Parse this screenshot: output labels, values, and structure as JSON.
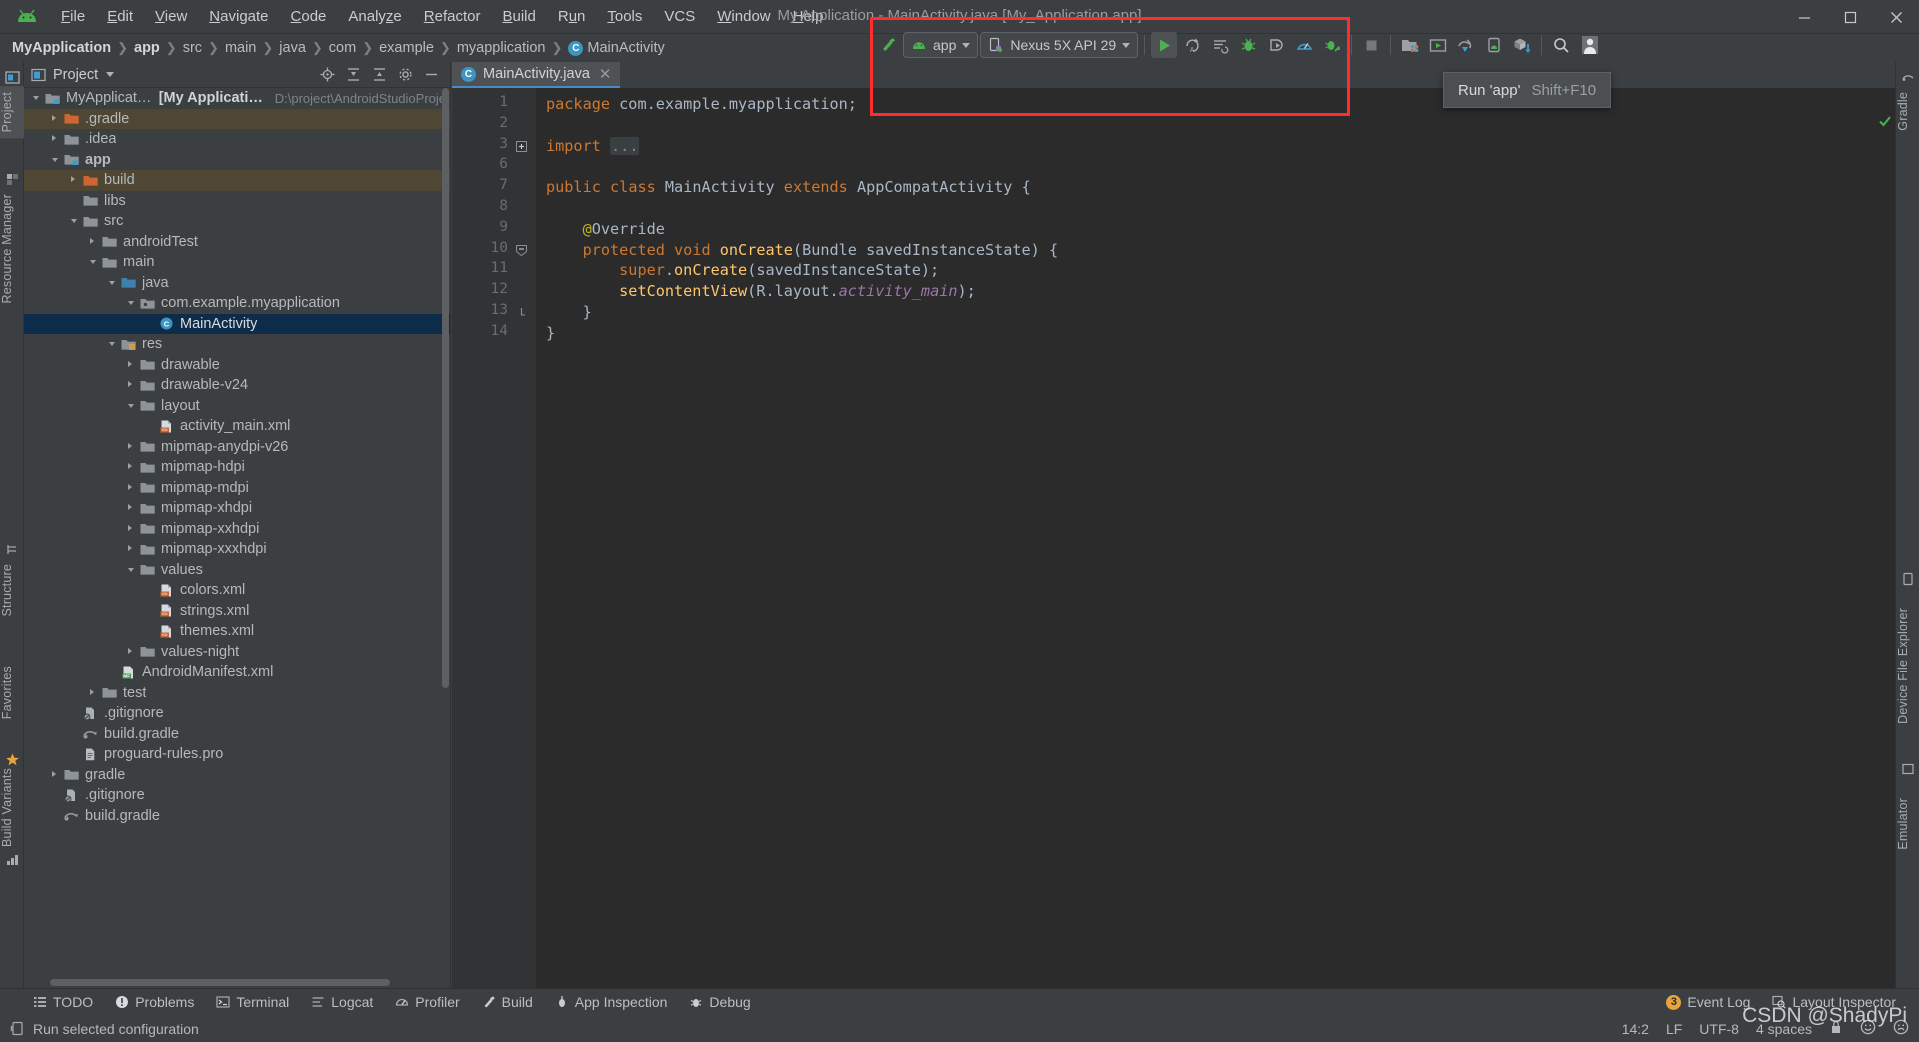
{
  "window": {
    "title": "My Application - MainActivity.java [My_Application.app]",
    "app_logo": "android-logo-icon",
    "minimize": "minimize-icon",
    "maximize": "maximize-icon",
    "close": "close-icon"
  },
  "menu": [
    {
      "label": "File",
      "mnemonic": "F"
    },
    {
      "label": "Edit",
      "mnemonic": "E"
    },
    {
      "label": "View",
      "mnemonic": "V"
    },
    {
      "label": "Navigate",
      "mnemonic": "N"
    },
    {
      "label": "Code",
      "mnemonic": "C"
    },
    {
      "label": "Analyze",
      "mnemonic": "z"
    },
    {
      "label": "Refactor",
      "mnemonic": "R"
    },
    {
      "label": "Build",
      "mnemonic": "B"
    },
    {
      "label": "Run",
      "mnemonic": "u"
    },
    {
      "label": "Tools",
      "mnemonic": "T"
    },
    {
      "label": "VCS",
      "mnemonic": ""
    },
    {
      "label": "Window",
      "mnemonic": "W"
    },
    {
      "label": "Help",
      "mnemonic": "H"
    }
  ],
  "breadcrumbs": [
    {
      "label": "MyApplication",
      "bold": true,
      "icon": ""
    },
    {
      "label": "app",
      "bold": true,
      "icon": ""
    },
    {
      "label": "src",
      "bold": false,
      "icon": ""
    },
    {
      "label": "main",
      "bold": false,
      "icon": ""
    },
    {
      "label": "java",
      "bold": false,
      "icon": ""
    },
    {
      "label": "com",
      "bold": false,
      "icon": ""
    },
    {
      "label": "example",
      "bold": false,
      "icon": ""
    },
    {
      "label": "myapplication",
      "bold": false,
      "icon": ""
    },
    {
      "label": "MainActivity",
      "bold": false,
      "icon": "class-icon"
    }
  ],
  "toolbar": {
    "build_icon": "hammer-icon",
    "module_selector": "app",
    "module_icon": "android-head-icon",
    "device_selector": "Nexus 5X API 29",
    "device_icon": "phone-icon",
    "run_button": "run-icon",
    "apply_changes_icon": "apply-changes-icon",
    "apply_code_changes_icon": "apply-code-changes-icon",
    "debug_icon": "debug-icon",
    "attach_debugger_icon": "attach-debugger-icon",
    "profiler_icon": "profiler-icon",
    "run_with_coverage_icon": "debug-attach-icon",
    "stop_icon": "stop-icon",
    "sdk_manager_icon": "sdk-manager-icon",
    "avd_manager_icon": "avd-manager-icon",
    "sync_gradle_icon": "sync-gradle-icon",
    "device_manager_icon": "device-manager-icon",
    "sdk_download_icon": "sdk-download-icon",
    "search_icon": "search-icon",
    "account_icon": "account-icon"
  },
  "tooltip": {
    "label": "Run 'app'",
    "shortcut": "Shift+F10"
  },
  "left_tool_tabs": [
    {
      "label": "Project",
      "icon": "project-icon",
      "active": true
    },
    {
      "label": "Resource Manager",
      "icon": "resource-icon",
      "active": false
    },
    {
      "label": "Structure",
      "icon": "structure-icon",
      "active": false
    },
    {
      "label": "Favorites",
      "icon": "star-icon",
      "active": false
    },
    {
      "label": "Build Variants",
      "icon": "build-variants-icon",
      "active": false
    }
  ],
  "right_tool_tabs": [
    {
      "label": "Gradle",
      "icon": "gradle-icon"
    },
    {
      "label": "Device File Explorer",
      "icon": "device-file-icon"
    },
    {
      "label": "Emulator",
      "icon": "emulator-icon"
    }
  ],
  "project_panel": {
    "title": "Project",
    "view_icon": "project-view-icon",
    "dropdown_icon": "chevron-down-icon",
    "icons": [
      "locate-icon",
      "expand-all-icon",
      "collapse-all-icon",
      "settings-icon",
      "hide-icon"
    ],
    "tree": [
      {
        "indent": 0,
        "arrow": "open",
        "icon": "module-folder",
        "label": "MyApplication",
        "bold_part": "[My Application]",
        "path": "D:\\project\\AndroidStudioProje",
        "state": "normal"
      },
      {
        "indent": 1,
        "arrow": "closed",
        "icon": "folder-orange",
        "label": ".gradle",
        "state": "excluded"
      },
      {
        "indent": 1,
        "arrow": "closed",
        "icon": "folder-gray",
        "label": ".idea",
        "state": "normal"
      },
      {
        "indent": 1,
        "arrow": "open",
        "icon": "module-folder",
        "label": "app",
        "bold": true,
        "state": "normal"
      },
      {
        "indent": 2,
        "arrow": "closed",
        "icon": "folder-orange",
        "label": "build",
        "state": "excluded"
      },
      {
        "indent": 2,
        "arrow": "none",
        "icon": "folder-gray",
        "label": "libs",
        "state": "normal"
      },
      {
        "indent": 2,
        "arrow": "open",
        "icon": "folder-gray",
        "label": "src",
        "state": "normal"
      },
      {
        "indent": 3,
        "arrow": "closed",
        "icon": "folder-gray",
        "label": "androidTest",
        "state": "normal"
      },
      {
        "indent": 3,
        "arrow": "open",
        "icon": "folder-gray",
        "label": "main",
        "state": "normal"
      },
      {
        "indent": 4,
        "arrow": "open",
        "icon": "folder-blue",
        "label": "java",
        "state": "normal"
      },
      {
        "indent": 5,
        "arrow": "open",
        "icon": "package-icon",
        "label": "com.example.myapplication",
        "state": "normal"
      },
      {
        "indent": 6,
        "arrow": "none",
        "icon": "class-icon",
        "label": "MainActivity",
        "state": "selected"
      },
      {
        "indent": 4,
        "arrow": "open",
        "icon": "res-folder",
        "label": "res",
        "state": "normal"
      },
      {
        "indent": 5,
        "arrow": "closed",
        "icon": "folder-gray",
        "label": "drawable",
        "state": "normal"
      },
      {
        "indent": 5,
        "arrow": "closed",
        "icon": "folder-gray",
        "label": "drawable-v24",
        "state": "normal"
      },
      {
        "indent": 5,
        "arrow": "open",
        "icon": "folder-gray",
        "label": "layout",
        "state": "normal"
      },
      {
        "indent": 6,
        "arrow": "none",
        "icon": "xml-icon",
        "label": "activity_main.xml",
        "state": "normal"
      },
      {
        "indent": 5,
        "arrow": "closed",
        "icon": "folder-gray",
        "label": "mipmap-anydpi-v26",
        "state": "normal"
      },
      {
        "indent": 5,
        "arrow": "closed",
        "icon": "folder-gray",
        "label": "mipmap-hdpi",
        "state": "normal"
      },
      {
        "indent": 5,
        "arrow": "closed",
        "icon": "folder-gray",
        "label": "mipmap-mdpi",
        "state": "normal"
      },
      {
        "indent": 5,
        "arrow": "closed",
        "icon": "folder-gray",
        "label": "mipmap-xhdpi",
        "state": "normal"
      },
      {
        "indent": 5,
        "arrow": "closed",
        "icon": "folder-gray",
        "label": "mipmap-xxhdpi",
        "state": "normal"
      },
      {
        "indent": 5,
        "arrow": "closed",
        "icon": "folder-gray",
        "label": "mipmap-xxxhdpi",
        "state": "normal"
      },
      {
        "indent": 5,
        "arrow": "open",
        "icon": "folder-gray",
        "label": "values",
        "state": "normal"
      },
      {
        "indent": 6,
        "arrow": "none",
        "icon": "xml-icon",
        "label": "colors.xml",
        "state": "normal"
      },
      {
        "indent": 6,
        "arrow": "none",
        "icon": "xml-icon",
        "label": "strings.xml",
        "state": "normal"
      },
      {
        "indent": 6,
        "arrow": "none",
        "icon": "xml-icon",
        "label": "themes.xml",
        "state": "normal"
      },
      {
        "indent": 5,
        "arrow": "closed",
        "icon": "folder-gray",
        "label": "values-night",
        "state": "normal"
      },
      {
        "indent": 4,
        "arrow": "none",
        "icon": "manifest-icon",
        "label": "AndroidManifest.xml",
        "state": "normal"
      },
      {
        "indent": 3,
        "arrow": "closed",
        "icon": "folder-gray",
        "label": "test",
        "state": "normal"
      },
      {
        "indent": 2,
        "arrow": "none",
        "icon": "gitignore-icon",
        "label": ".gitignore",
        "state": "normal"
      },
      {
        "indent": 2,
        "arrow": "none",
        "icon": "gradle-file-icon",
        "label": "build.gradle",
        "state": "normal"
      },
      {
        "indent": 2,
        "arrow": "none",
        "icon": "text-file-icon",
        "label": "proguard-rules.pro",
        "state": "normal"
      },
      {
        "indent": 1,
        "arrow": "closed",
        "icon": "folder-gray",
        "label": "gradle",
        "state": "normal"
      },
      {
        "indent": 1,
        "arrow": "none",
        "icon": "gitignore-icon",
        "label": ".gitignore",
        "state": "normal"
      },
      {
        "indent": 1,
        "arrow": "none",
        "icon": "gradle-file-icon",
        "label": "build.gradle",
        "state": "normal"
      }
    ]
  },
  "editor": {
    "tab": {
      "label": "MainActivity.java",
      "icon": "class-icon",
      "close": "close-icon"
    },
    "lines": [
      {
        "num": "1",
        "mark": "",
        "fold": ""
      },
      {
        "num": "2",
        "mark": "",
        "fold": ""
      },
      {
        "num": "3",
        "mark": "",
        "fold": "plus"
      },
      {
        "num": "6",
        "mark": "",
        "fold": ""
      },
      {
        "num": "7",
        "mark": "xml-icon",
        "fold": ""
      },
      {
        "num": "8",
        "mark": "",
        "fold": ""
      },
      {
        "num": "9",
        "mark": "",
        "fold": ""
      },
      {
        "num": "10",
        "mark": "override-icon",
        "fold": "minus"
      },
      {
        "num": "11",
        "mark": "",
        "fold": ""
      },
      {
        "num": "12",
        "mark": "",
        "fold": ""
      },
      {
        "num": "13",
        "mark": "",
        "fold": "end"
      },
      {
        "num": "14",
        "mark": "",
        "fold": ""
      }
    ],
    "code_text": [
      "package com.example.myapplication;",
      "",
      "import ...",
      "",
      "public class MainActivity extends AppCompatActivity {",
      "",
      "    @Override",
      "    protected void onCreate(Bundle savedInstanceState) {",
      "        super.onCreate(savedInstanceState);",
      "        setContentView(R.layout.activity_main);",
      "    }",
      "}"
    ],
    "inspection_status": "check-icon"
  },
  "bottom_tabs": [
    {
      "label": "TODO",
      "icon": "todo-icon"
    },
    {
      "label": "Problems",
      "icon": "problems-icon"
    },
    {
      "label": "Terminal",
      "icon": "terminal-icon"
    },
    {
      "label": "Logcat",
      "icon": "logcat-icon"
    },
    {
      "label": "Profiler",
      "icon": "profiler-icon"
    },
    {
      "label": "Build",
      "icon": "build-icon"
    },
    {
      "label": "App Inspection",
      "icon": "app-inspection-icon"
    },
    {
      "label": "Debug",
      "icon": "debug-icon"
    }
  ],
  "bottom_right": [
    {
      "label": "Event Log",
      "icon": "event-log-icon",
      "badge": "3"
    },
    {
      "label": "Layout Inspector",
      "icon": "layout-inspector-icon",
      "badge": ""
    }
  ],
  "statusbar": {
    "message": "Run selected configuration",
    "message_icon": "run-config-icon",
    "caret_position": "14:2",
    "line_separator": "LF",
    "encoding": "UTF-8",
    "indent": "4 spaces",
    "lock_icon": "lock-icon",
    "happy_icon": "happy-face-icon",
    "sad_icon": "sad-face-icon"
  },
  "watermark": "CSDN @ShadyPi",
  "colors": {
    "accent_green": "#4caf50",
    "accent_blue": "#4a88c7",
    "red_annotation": "#ff2d2d",
    "selection": "#0d2c4a",
    "excluded": "#4f4733"
  }
}
